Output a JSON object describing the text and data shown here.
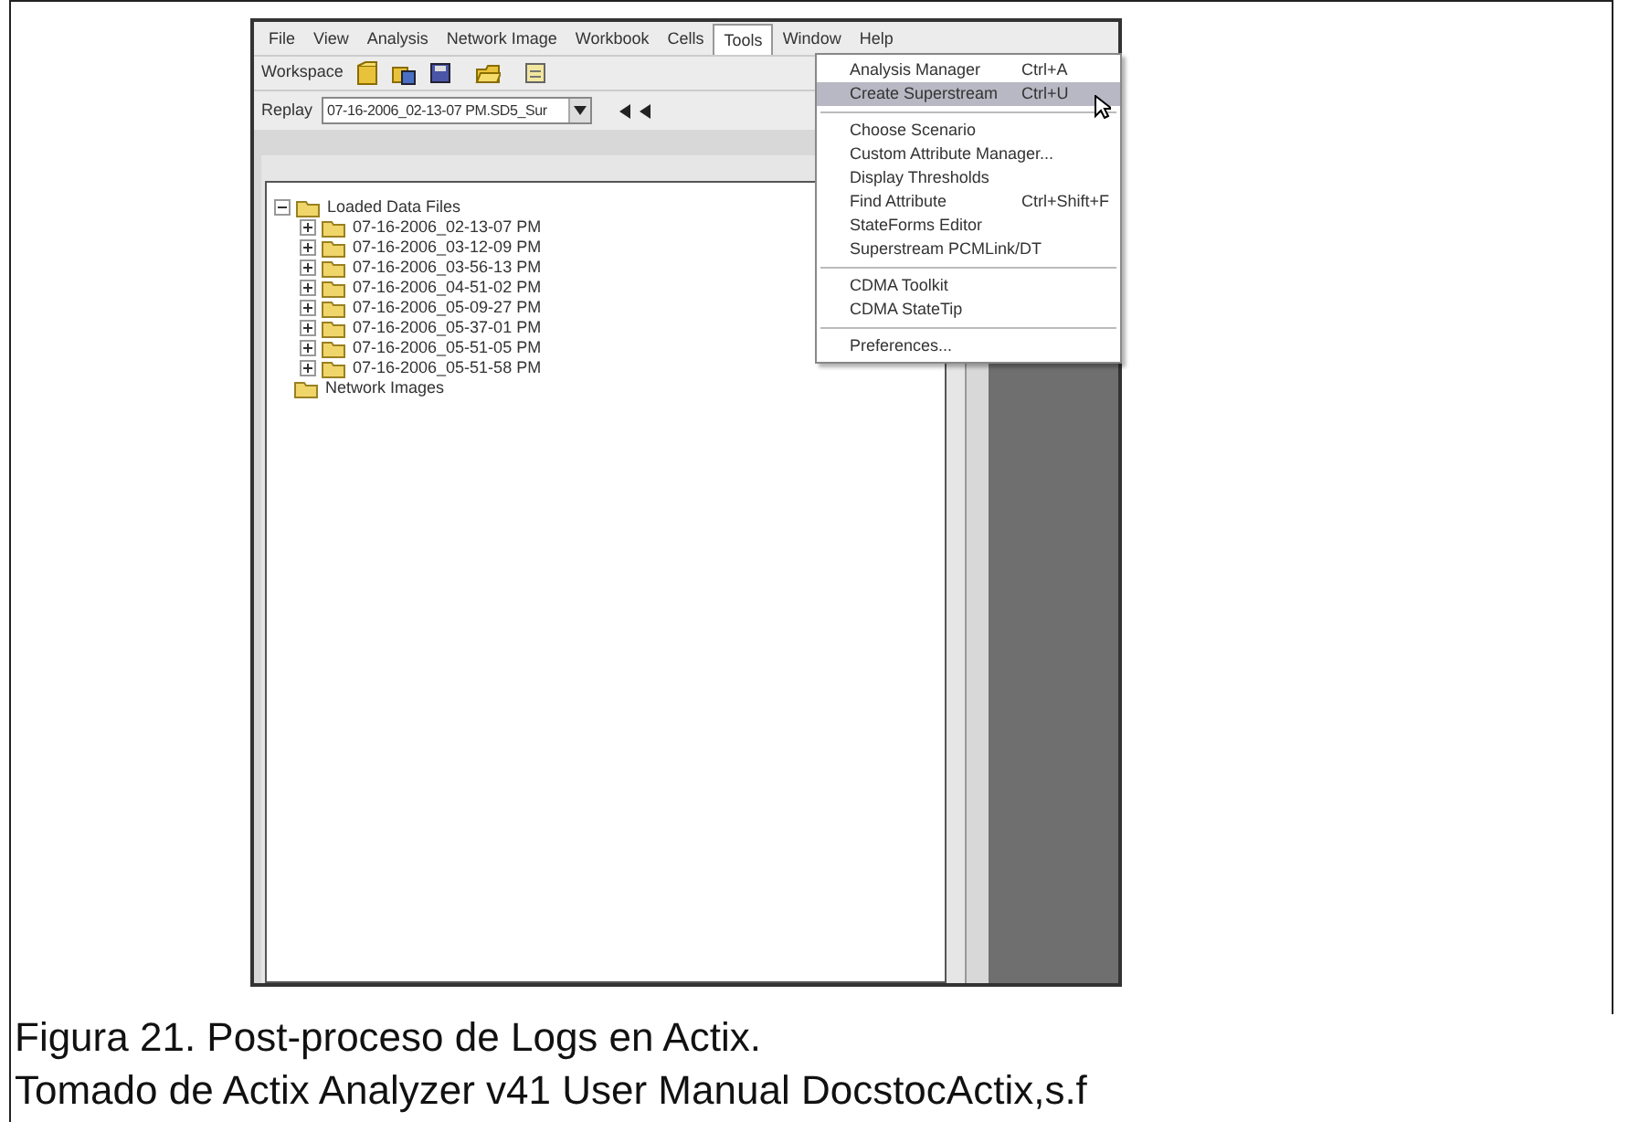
{
  "screenshot": {
    "menu_bar": [
      {
        "label": "File",
        "selected": false
      },
      {
        "label": "View",
        "selected": false
      },
      {
        "label": "Analysis",
        "selected": false
      },
      {
        "label": "Network Image",
        "selected": false
      },
      {
        "label": "Workbook",
        "selected": false
      },
      {
        "label": "Cells",
        "selected": false
      },
      {
        "label": "Tools",
        "selected": true
      },
      {
        "label": "Window",
        "selected": false
      },
      {
        "label": "Help",
        "selected": false
      }
    ],
    "toolbar": {
      "label": "Workspace"
    },
    "replay": {
      "label": "Replay",
      "value": "07-16-2006_02-13-07 PM.SD5_Sur"
    },
    "tree": [
      {
        "label": "Loaded Data Files",
        "expanded": true,
        "children": [
          {
            "label": "07-16-2006_02-13-07 PM",
            "expanded": false
          },
          {
            "label": "07-16-2006_03-12-09 PM",
            "expanded": false
          },
          {
            "label": "07-16-2006_03-56-13 PM",
            "expanded": false
          },
          {
            "label": "07-16-2006_04-51-02 PM",
            "expanded": false
          },
          {
            "label": "07-16-2006_05-09-27 PM",
            "expanded": false
          },
          {
            "label": "07-16-2006_05-37-01 PM",
            "expanded": false
          },
          {
            "label": "07-16-2006_05-51-05 PM",
            "expanded": false
          },
          {
            "label": "07-16-2006_05-51-58 PM",
            "expanded": false
          }
        ]
      },
      {
        "label": "Network Images"
      }
    ],
    "tools_menu": [
      {
        "kind": "item",
        "label": "Analysis Manager",
        "shortcut": "Ctrl+A",
        "selected": false
      },
      {
        "kind": "item",
        "label": "Create Superstream",
        "shortcut": "Ctrl+U",
        "selected": true
      },
      {
        "kind": "separator"
      },
      {
        "kind": "item",
        "label": "Choose Scenario",
        "selected": false
      },
      {
        "kind": "item",
        "label": "Custom Attribute Manager...",
        "selected": false
      },
      {
        "kind": "item",
        "label": "Display Thresholds",
        "selected": false
      },
      {
        "kind": "item",
        "label": "Find Attribute",
        "shortcut": "Ctrl+Shift+F",
        "selected": false
      },
      {
        "kind": "item",
        "label": "StateForms Editor",
        "selected": false
      },
      {
        "kind": "item",
        "label": "Superstream PCMLink/DT",
        "selected": false
      },
      {
        "kind": "separator"
      },
      {
        "kind": "item",
        "label": "CDMA Toolkit",
        "selected": false
      },
      {
        "kind": "item",
        "label": "CDMA StateTip",
        "selected": false
      },
      {
        "kind": "separator"
      },
      {
        "kind": "item",
        "label": "Preferences...",
        "selected": false
      }
    ]
  },
  "caption": [
    "Figura 21. Post-proceso de Logs en Actix.",
    "Tomado de Actix Analyzer v41 User Manual DocstocActix,s.f"
  ]
}
